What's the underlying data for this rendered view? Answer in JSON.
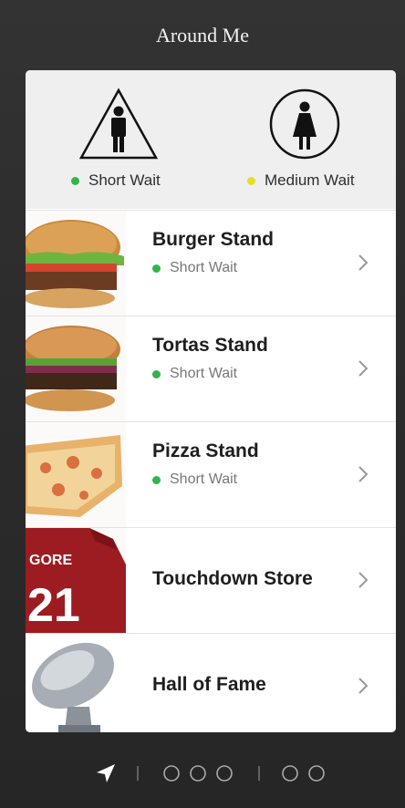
{
  "header": {
    "title": "Around Me"
  },
  "restrooms": {
    "men": {
      "label": "Short Wait",
      "status_color": "#33b44a",
      "icon": "mens-restroom-icon"
    },
    "women": {
      "label": "Medium Wait",
      "status_color": "#e8dd2a",
      "icon": "womens-restroom-icon"
    }
  },
  "places": [
    {
      "name": "Burger Stand",
      "status": "Short Wait",
      "status_color": "#33b44a",
      "image": "burger-image"
    },
    {
      "name": "Tortas Stand",
      "status": "Short Wait",
      "status_color": "#33b44a",
      "image": "torta-image"
    },
    {
      "name": "Pizza Stand",
      "status": "Short Wait",
      "status_color": "#33b44a",
      "image": "pizza-image"
    },
    {
      "name": "Touchdown Store",
      "image": "jersey-image"
    },
    {
      "name": "Hall of Fame",
      "image": "trophy-image"
    }
  ],
  "jersey": {
    "name": "GORE",
    "number": "21"
  },
  "nav": {
    "icons": [
      "location-arrow-icon",
      "page-dot-icon",
      "page-dot-icon",
      "page-dot-icon",
      "page-dot-icon",
      "page-dot-icon"
    ]
  }
}
